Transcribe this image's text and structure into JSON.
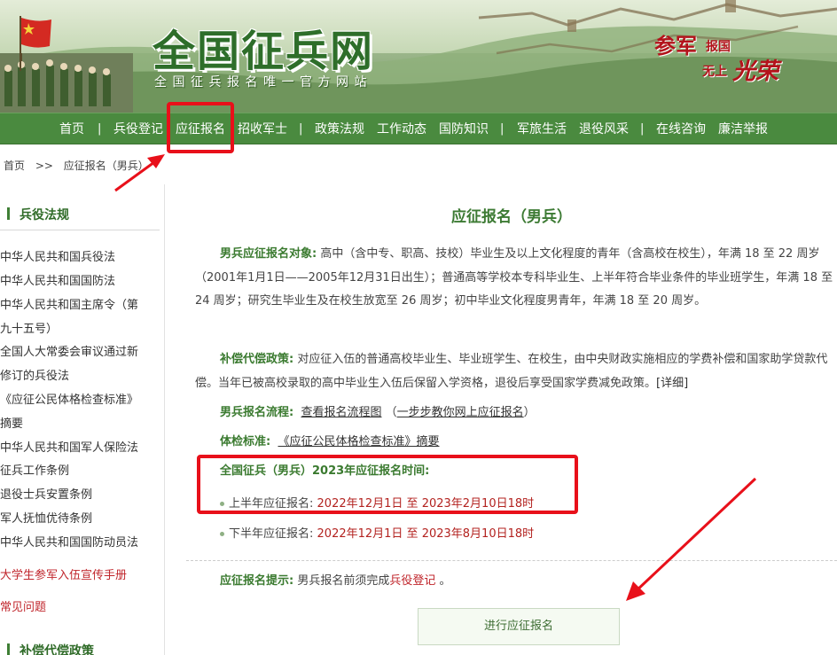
{
  "banner": {
    "title": "全国征兵网",
    "subtitle": "全国征兵报名唯一官方网站",
    "slogan_1": "参军",
    "slogan_2": "报国",
    "slogan_3": "无上",
    "slogan_4": "光荣"
  },
  "nav": {
    "items": [
      {
        "label": "首页"
      },
      {
        "label": "兵役登记"
      },
      {
        "label": "应征报名"
      },
      {
        "label": "招收军士"
      },
      {
        "label": "政策法规"
      },
      {
        "label": "工作动态"
      },
      {
        "label": "国防知识"
      },
      {
        "label": "军旅生活"
      },
      {
        "label": "退役风采"
      },
      {
        "label": "在线咨询"
      },
      {
        "label": "廉洁举报"
      }
    ],
    "separator": "|"
  },
  "breadcrumb": {
    "home": "首页",
    "sep": ">>",
    "current": "应征报名（男兵）"
  },
  "sidebar": {
    "section_1": "兵役法规",
    "links": [
      "中华人民共和国兵役法",
      "中华人民共和国国防法",
      "中华人民共和国主席令（第",
      "九十五号）",
      "全国人大常委会审议通过新",
      "修订的兵役法",
      "《应征公民体格检查标准》",
      "摘要",
      "中华人民共和国军人保险法",
      "征兵工作条例",
      "退役士兵安置条例",
      "军人抚恤优待条例",
      "中华人民共和国国防动员法"
    ],
    "link_handbook": "大学生参军入伍宣传手册",
    "link_faq": "常见问题",
    "section_2": "补偿代偿政策"
  },
  "main": {
    "title": "应征报名（男兵）",
    "target_label": "男兵应征报名对象:",
    "target_text": " 高中（含中专、职高、技校）毕业生及以上文化程度的青年（含高校在校生），年满 18 至 22 周岁（2001年1月1日——2005年12月31日出生）；普通高等学校本专科毕业生、上半年符合毕业条件的毕业班学生，年满 18 至 24 周岁；研究生毕业生及在校生放宽至 26 周岁；初中毕业文化程度男青年，年满 18 至 20 周岁。",
    "comp_label": "补偿代偿政策:",
    "comp_text": " 对应征入伍的普通高校毕业生、毕业班学生、在校生，由中央财政实施相应的学费补偿和国家助学贷款代偿。当年已被高校录取的高中毕业生入伍后保留入学资格，退役后享受国家学费减免政策。",
    "comp_detail": "[详细]",
    "process_label": "男兵报名流程:",
    "process_link": "查看报名流程图",
    "process_paren_open": "（",
    "process_link_2": "一步步教你网上应征报名",
    "process_paren_close": "）",
    "exam_label": "体检标准:",
    "exam_link": "《应征公民体格检查标准》摘要",
    "period_title": "全国征兵（男兵）2023年应征报名时间:",
    "period_1_label": "上半年应征报名:",
    "period_1_value": "2022年12月1日 至 2023年2月10日18时",
    "period_2_label": "下半年应征报名:",
    "period_2_value": "2022年12月1日 至 2023年8月10日18时",
    "tip_label": "应征报名提示:",
    "tip_text": " 男兵报名前须完成",
    "tip_link": "兵役登记",
    "tip_end": " 。",
    "button": "进行应征报名"
  },
  "colors": {
    "nav_bg": "#4a8a3f",
    "accent_green": "#3a7a2f",
    "date_red": "#b3221f",
    "annotation_red": "#e8101a"
  }
}
